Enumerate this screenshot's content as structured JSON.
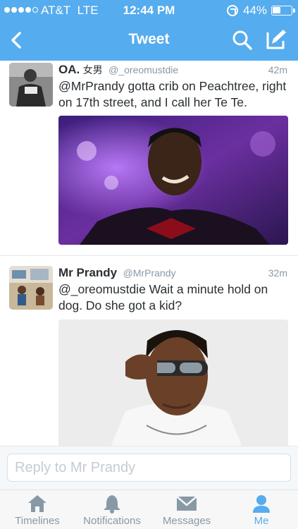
{
  "status_bar": {
    "carrier": "AT&T",
    "network": "LTE",
    "time": "12:44 PM",
    "battery_percent": "44%",
    "battery_level": 0.44,
    "signal_bars_filled": 4,
    "signal_bars_total": 5
  },
  "nav": {
    "title": "Tweet",
    "back_icon": "chevron-left-icon",
    "search_icon": "search-icon",
    "compose_icon": "compose-icon"
  },
  "tweets": [
    {
      "name": "OA.",
      "name_badge": "女男",
      "handle": "@_oreomustdie",
      "time": "42m",
      "text": "@MrPrandy gotta crib on Peachtree, right on 17th street, and I call her Te Te."
    },
    {
      "name": "Mr Prandy",
      "handle": "@MrPrandy",
      "time": "32m",
      "text": "@_oreomustdie  Wait a minute hold on dog. Do she got a kid?"
    }
  ],
  "reply": {
    "placeholder": "Reply to Mr Prandy"
  },
  "tabs": [
    {
      "label": "Timelines",
      "icon": "home-icon",
      "active": false
    },
    {
      "label": "Notifications",
      "icon": "bell-icon",
      "active": false
    },
    {
      "label": "Messages",
      "icon": "envelope-icon",
      "active": false
    },
    {
      "label": "Me",
      "icon": "person-icon",
      "active": true
    }
  ],
  "colors": {
    "brand": "#55acee",
    "text": "#292f33",
    "muted": "#8899a6"
  }
}
